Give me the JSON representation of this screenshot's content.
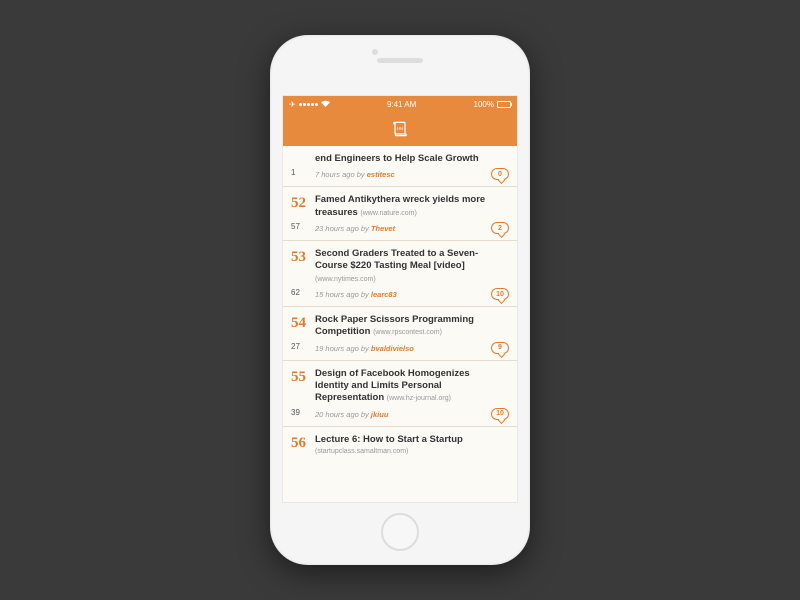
{
  "status": {
    "carrier_dots": 5,
    "time": "9:41 AM",
    "battery": "100%"
  },
  "app": {
    "logo_label": "HN"
  },
  "stories": [
    {
      "rank": "",
      "score": "1",
      "title": "end Engineers to Help Scale Growth",
      "domain": "",
      "age": "7 hours ago",
      "by_label": "by",
      "author": "estitesc",
      "comments": "0"
    },
    {
      "rank": "52",
      "score": "57",
      "title": "Famed Antikythera wreck yields more treasures",
      "domain": "(www.nature.com)",
      "age": "23 hours ago",
      "by_label": "by",
      "author": "Thevet",
      "comments": "2"
    },
    {
      "rank": "53",
      "score": "62",
      "title": "Second Graders Treated to a Seven-Course $220 Tasting Meal [video]",
      "domain": "(www.nytimes.com)",
      "age": "15 hours ago",
      "by_label": "by",
      "author": "learc83",
      "comments": "10"
    },
    {
      "rank": "54",
      "score": "27",
      "title": "Rock Paper Scissors Programming Competition",
      "domain": "(www.rpscontest.com)",
      "age": "19 hours ago",
      "by_label": "by",
      "author": "bvaldivielso",
      "comments": "9"
    },
    {
      "rank": "55",
      "score": "39",
      "title": "Design of Facebook Homogenizes Identity and Limits Personal Representation",
      "domain": "(www.hz-journal.org)",
      "age": "20 hours ago",
      "by_label": "by",
      "author": "jkiuu",
      "comments": "10"
    },
    {
      "rank": "56",
      "score": "",
      "title": "Lecture 6: How to Start a Startup",
      "domain": "(startupclass.samaltman.com)",
      "age": "",
      "by_label": "",
      "author": "",
      "comments": ""
    }
  ]
}
